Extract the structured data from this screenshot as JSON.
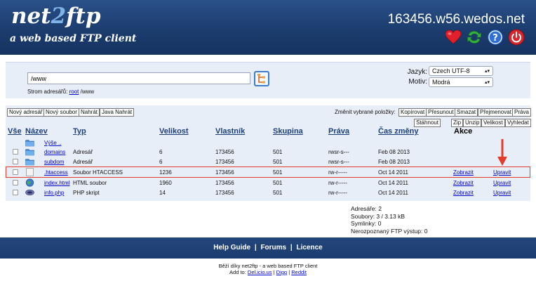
{
  "header": {
    "logo_main_a": "net",
    "logo_main_b": "2",
    "logo_main_c": "ftp",
    "logo_sub": "a web based FTP client",
    "host": "163456.w56.wedos.net",
    "icons": [
      "heart-icon",
      "refresh-icon",
      "help-icon",
      "power-icon"
    ]
  },
  "top": {
    "directory_value": "/www",
    "tree_label": "Strom adresářů:",
    "tree_root": "root",
    "tree_path": "/www",
    "language_label": "Jazyk:",
    "language_value": "Czech UTF-8",
    "skin_label": "Motiv:",
    "skin_value": "Modrá"
  },
  "toolbar": {
    "new_dir": "Nový adresář",
    "new_file": "Nový soubor",
    "upload": "Nahrát",
    "java_upload": "Java Nahrát",
    "change_label": "Změnit vybrané položky:",
    "copy": "Kopírovat",
    "move": "Přesunout",
    "delete": "Smazat",
    "rename": "Přejmenovat",
    "chmod": "Práva",
    "download": "Stáhnout",
    "zip": "Zip",
    "unzip": "Unzip",
    "size": "Velikost",
    "search": "Vyhledat"
  },
  "table": {
    "headers": {
      "all": "Vše",
      "name": "Název",
      "type": "Typ",
      "size": "Velikost",
      "owner": "Vlastník",
      "group": "Skupina",
      "perms": "Práva",
      "mtime": "Čas změny",
      "actions": "Akce"
    },
    "up_label": "Výše ..",
    "rows": [
      {
        "name": "domains",
        "type": "Adresář",
        "size": "6",
        "owner": "173456",
        "group": "501",
        "perms": "rwsr-s---",
        "mtime": "Feb 08 2013",
        "view": "",
        "edit": ""
      },
      {
        "name": "subdom",
        "type": "Adresář",
        "size": "6",
        "owner": "173456",
        "group": "501",
        "perms": "rwsr-s---",
        "mtime": "Feb 08 2013",
        "view": "",
        "edit": ""
      },
      {
        "name": ".htaccess",
        "type": "Soubor HTACCESS",
        "size": "1236",
        "owner": "173456",
        "group": "501",
        "perms": "rw-r-----",
        "mtime": "Oct 14 2011",
        "view": "Zobrazit",
        "edit": "Upravit"
      },
      {
        "name": "index.html",
        "type": "HTML soubor",
        "size": "1960",
        "owner": "173456",
        "group": "501",
        "perms": "rw-r-----",
        "mtime": "Oct 14 2011",
        "view": "Zobrazit",
        "edit": "Upravit"
      },
      {
        "name": "info.php",
        "type": "PHP skript",
        "size": "14",
        "owner": "173456",
        "group": "501",
        "perms": "rw-r-----",
        "mtime": "Oct 14 2011",
        "view": "Zobrazit",
        "edit": "Upravit"
      }
    ]
  },
  "stats": {
    "dirs": "Adresáře: 2",
    "files": "Soubory: 3 / 3.13 kB",
    "symlinks": "Symlinky: 0",
    "unrecognized": "Nerozpoznaný FTP výstup: 0"
  },
  "footer": {
    "help": "Help Guide",
    "forums": "Forums",
    "license": "Licence",
    "sep": "|"
  },
  "credits": {
    "line1": "Běží díky net2ftp - a web based FTP client",
    "add_to": "Add to:",
    "delicious": "Del.icio.us",
    "digg": "Digg",
    "reddit": "Reddit",
    "sep": "|"
  },
  "colors": {
    "header_bg": "#1b3c6e",
    "panel_bg": "#e8eef7",
    "link": "#0000cc",
    "highlight": "#e43c2a"
  }
}
